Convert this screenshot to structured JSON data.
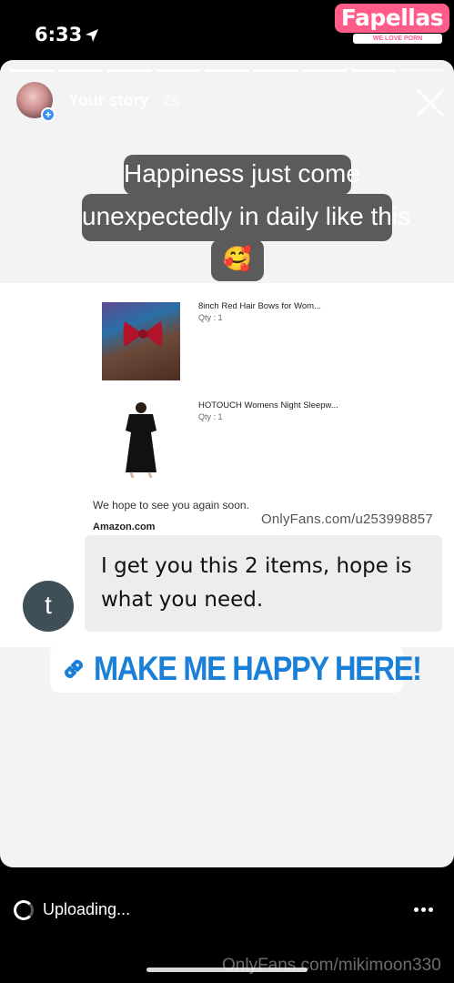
{
  "status_bar": {
    "time": "6:33",
    "location_icon": "location-arrow-icon"
  },
  "watermark_logo": {
    "title": "Fapellas",
    "tagline": "WE LOVE PORN"
  },
  "story": {
    "progress_segments": 9,
    "user": "Your story",
    "time_ago": "2s",
    "close_icon": "close-icon",
    "caption_lines": [
      "Happiness just come",
      "unexpectedly in daily like this",
      "🥰"
    ]
  },
  "order": {
    "items": [
      {
        "title": "8inch Red Hair Bows for Wom...",
        "qty": "Qty : 1"
      },
      {
        "title": "HOTOUCH Womens Night Sleepw...",
        "qty": "Qty : 1"
      }
    ],
    "footer_text": "We hope to see you again soon.",
    "brand": "Amazon.com"
  },
  "watermarks": {
    "top": "OnlyFans.com/u253998857",
    "bottom": "OnlyFans.com/mikimoon330"
  },
  "message": {
    "avatar_letter": "t",
    "text_line1": "I get you this 2 items, hope is",
    "text_line2": "what you need."
  },
  "link_sticker": {
    "label": "MAKE ME HAPPY HERE!",
    "icon": "link-icon",
    "color": "#1a7fd6"
  },
  "bottom_bar": {
    "status": "Uploading...",
    "more_icon": "more-dots-icon"
  }
}
